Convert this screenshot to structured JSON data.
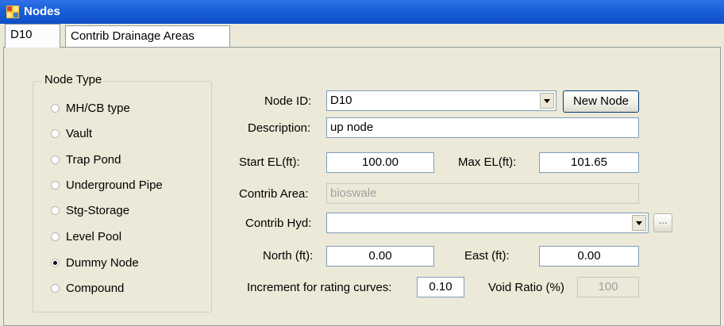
{
  "window": {
    "title": "Nodes",
    "icon": "app-grid-icon"
  },
  "tabs": [
    {
      "label": "D10",
      "selected": true
    },
    {
      "label": "Contrib Drainage Areas",
      "selected": false
    }
  ],
  "node_type": {
    "legend": "Node Type",
    "options": [
      {
        "label": "MH/CB type",
        "checked": false
      },
      {
        "label": "Vault",
        "checked": false
      },
      {
        "label": "Trap Pond",
        "checked": false
      },
      {
        "label": "Underground Pipe",
        "checked": false
      },
      {
        "label": "Stg-Storage",
        "checked": false
      },
      {
        "label": "Level Pool",
        "checked": false
      },
      {
        "label": "Dummy Node",
        "checked": true
      },
      {
        "label": "Compound",
        "checked": false
      }
    ]
  },
  "form": {
    "node_id_label": "Node ID:",
    "node_id_value": "D10",
    "new_node_button": "New Node",
    "description_label": "Description:",
    "description_value": "up node",
    "start_el_label": "Start EL(ft):",
    "start_el_value": "100.00",
    "max_el_label": "Max EL(ft):",
    "max_el_value": "101.65",
    "contrib_area_label": "Contrib Area:",
    "contrib_area_value": "bioswale",
    "contrib_hyd_label": "Contrib Hyd:",
    "contrib_hyd_value": "",
    "browse_button": "...",
    "north_label": "North (ft):",
    "north_value": "0.00",
    "east_label": "East (ft):",
    "east_value": "0.00",
    "increment_label": "Increment for rating curves:",
    "increment_value": "0.10",
    "void_ratio_label": "Void Ratio (%)",
    "void_ratio_value": "100"
  }
}
